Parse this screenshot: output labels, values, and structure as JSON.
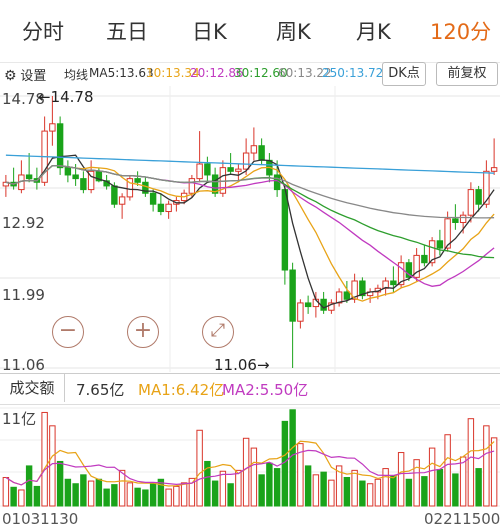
{
  "tabs": [
    "分时",
    "五日",
    "日K",
    "周K",
    "月K",
    "120分"
  ],
  "active_tab": 5,
  "toolbar": {
    "settings_label": "设置",
    "ma_prefix": "均线",
    "ma_items": [
      {
        "label": "MA5:13.63",
        "color": "#333333"
      },
      {
        "label": "10:13.34",
        "color": "#e8a317"
      },
      {
        "label": "20:12.86",
        "color": "#c03ac0"
      },
      {
        "label": "30:12.60",
        "color": "#2e9e2e"
      },
      {
        "label": "60:13.22",
        "color": "#888888"
      },
      {
        "label": "250:13.72",
        "color": "#3aa0d8"
      }
    ],
    "dk_label": "DK点",
    "adjust_label": "前复权"
  },
  "price_axis": {
    "labels": [
      "14.78",
      "12.92",
      "11.99",
      "11.06"
    ]
  },
  "annotations": {
    "high_label": "←14.78",
    "low_label": "11.06→"
  },
  "controls": {
    "zoom_out": "−",
    "zoom_in": "+",
    "fullscreen": "⤢"
  },
  "volume_header": {
    "title": "成交额",
    "value": "7.65亿",
    "ma1": "MA1:6.42亿",
    "ma2": "MA2:5.50亿",
    "ma1_color": "#e8a317",
    "ma2_color": "#c03ac0"
  },
  "volume_axis": {
    "max_label": "11亿"
  },
  "dates": {
    "start": "01031130",
    "end": "02211500"
  },
  "colors": {
    "up": "#d9352a",
    "down": "#1aa31a",
    "accent": "#e36a17"
  },
  "chart_data": {
    "type": "candlestick",
    "candles": [
      [
        13.55,
        13.7,
        13.4,
        13.6
      ],
      [
        13.6,
        13.8,
        13.5,
        13.55
      ],
      [
        13.5,
        13.9,
        13.45,
        13.7
      ],
      [
        13.7,
        14.0,
        13.6,
        13.65
      ],
      [
        13.65,
        13.8,
        13.5,
        13.6
      ],
      [
        13.6,
        14.5,
        13.55,
        14.3
      ],
      [
        14.3,
        14.78,
        14.1,
        14.4
      ],
      [
        14.4,
        14.5,
        13.7,
        13.8
      ],
      [
        13.8,
        13.9,
        13.6,
        13.7
      ],
      [
        13.7,
        13.85,
        13.55,
        13.65
      ],
      [
        13.65,
        13.75,
        13.45,
        13.5
      ],
      [
        13.5,
        13.9,
        13.45,
        13.75
      ],
      [
        13.75,
        13.8,
        13.6,
        13.62
      ],
      [
        13.62,
        13.7,
        13.5,
        13.55
      ],
      [
        13.55,
        13.6,
        13.25,
        13.3
      ],
      [
        13.3,
        13.45,
        13.1,
        13.4
      ],
      [
        13.4,
        13.7,
        13.35,
        13.65
      ],
      [
        13.65,
        13.75,
        13.55,
        13.6
      ],
      [
        13.6,
        13.68,
        13.4,
        13.45
      ],
      [
        13.45,
        13.5,
        13.2,
        13.3
      ],
      [
        13.3,
        13.45,
        13.15,
        13.2
      ],
      [
        13.2,
        13.35,
        13.1,
        13.3
      ],
      [
        13.3,
        13.4,
        13.2,
        13.35
      ],
      [
        13.35,
        13.5,
        13.3,
        13.45
      ],
      [
        13.45,
        13.7,
        13.4,
        13.65
      ],
      [
        13.65,
        14.3,
        13.6,
        13.85
      ],
      [
        13.85,
        13.95,
        13.6,
        13.7
      ],
      [
        13.7,
        13.8,
        13.4,
        13.45
      ],
      [
        13.45,
        13.9,
        13.4,
        13.8
      ],
      [
        13.8,
        14.0,
        13.7,
        13.75
      ],
      [
        13.75,
        13.85,
        13.6,
        13.78
      ],
      [
        13.78,
        14.2,
        13.7,
        14.0
      ],
      [
        14.0,
        14.35,
        13.9,
        14.1
      ],
      [
        14.1,
        14.2,
        13.85,
        13.9
      ],
      [
        13.9,
        14.0,
        13.6,
        13.7
      ],
      [
        13.7,
        13.9,
        13.4,
        13.5
      ],
      [
        13.5,
        13.55,
        12.2,
        12.4
      ],
      [
        12.4,
        12.5,
        11.06,
        11.7
      ],
      [
        11.7,
        12.0,
        11.6,
        11.95
      ],
      [
        11.95,
        12.05,
        11.8,
        11.9
      ],
      [
        11.9,
        12.1,
        11.75,
        12.0
      ],
      [
        12.0,
        12.1,
        11.8,
        11.85
      ],
      [
        11.85,
        12.0,
        11.8,
        11.95
      ],
      [
        11.95,
        12.15,
        11.9,
        12.1
      ],
      [
        12.1,
        12.25,
        11.95,
        12.0
      ],
      [
        12.0,
        12.35,
        11.95,
        12.25
      ],
      [
        12.25,
        12.3,
        12.0,
        12.05
      ],
      [
        12.05,
        12.15,
        11.95,
        12.1
      ],
      [
        12.1,
        12.2,
        12.0,
        12.15
      ],
      [
        12.15,
        12.3,
        12.05,
        12.25
      ],
      [
        12.25,
        12.45,
        12.1,
        12.2
      ],
      [
        12.2,
        12.6,
        12.15,
        12.5
      ],
      [
        12.5,
        12.55,
        12.25,
        12.3
      ],
      [
        12.3,
        12.7,
        12.25,
        12.6
      ],
      [
        12.6,
        12.75,
        12.45,
        12.5
      ],
      [
        12.5,
        12.85,
        12.45,
        12.8
      ],
      [
        12.8,
        12.95,
        12.6,
        12.7
      ],
      [
        12.7,
        13.2,
        12.65,
        13.1
      ],
      [
        13.1,
        13.3,
        12.95,
        13.05
      ],
      [
        13.05,
        13.2,
        12.9,
        13.15
      ],
      [
        13.15,
        13.6,
        13.05,
        13.5
      ],
      [
        13.5,
        13.55,
        13.2,
        13.3
      ],
      [
        13.3,
        13.9,
        13.25,
        13.75
      ],
      [
        13.75,
        14.2,
        13.7,
        13.8
      ]
    ],
    "volumes": [
      3.2,
      2.1,
      1.8,
      4.5,
      2.2,
      10.5,
      9.0,
      5.0,
      3.0,
      2.5,
      3.5,
      2.8,
      3.0,
      1.9,
      2.4,
      4.0,
      2.6,
      2.0,
      1.8,
      2.5,
      3.0,
      1.9,
      2.2,
      2.6,
      3.1,
      8.5,
      5.0,
      2.8,
      3.9,
      2.5,
      4.0,
      7.6,
      6.5,
      3.5,
      4.8,
      4.2,
      9.5,
      10.8,
      7.0,
      4.5,
      3.5,
      3.8,
      2.9,
      4.5,
      3.2,
      4.0,
      2.8,
      2.5,
      3.0,
      4.2,
      3.4,
      6.0,
      3.0,
      5.2,
      3.3,
      6.5,
      4.1,
      8.0,
      3.6,
      5.5,
      9.8,
      4.2,
      9.0,
      7.65
    ],
    "price_range": [
      11.06,
      14.78
    ]
  }
}
